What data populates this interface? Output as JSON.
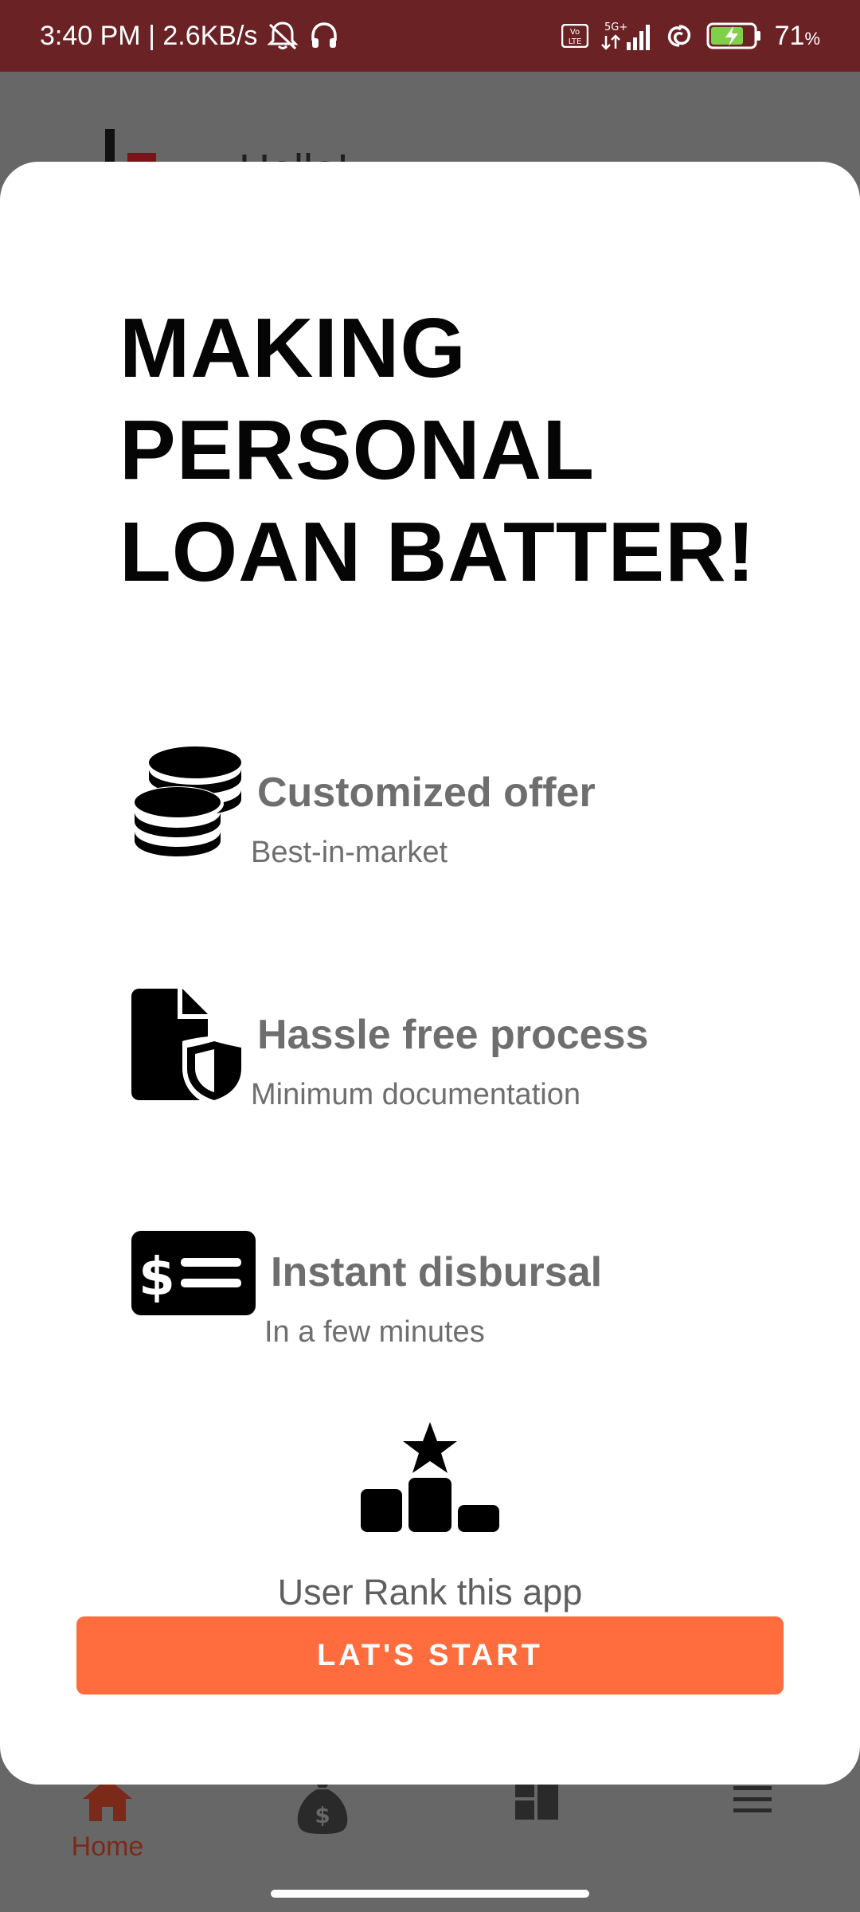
{
  "status_bar": {
    "time_speed": "3:40 PM | 2.6KB/s",
    "network_badge": "5G+",
    "volte_badge": "Vo LTE",
    "battery": "71",
    "battery_unit": "%"
  },
  "background": {
    "greeting": "Hello!",
    "nav": {
      "home_label": "Home"
    }
  },
  "modal": {
    "headline": [
      "MAKING",
      "PERSONAL",
      "LOAN BATTER!"
    ],
    "features": [
      {
        "title": "Customized offer",
        "subtitle": "Best-in-market",
        "icon": "coins-icon"
      },
      {
        "title": "Hassle free process",
        "subtitle": "Minimum documentation",
        "icon": "document-shield-icon"
      },
      {
        "title": "Instant disbursal",
        "subtitle": "In a few minutes",
        "icon": "money-bill-icon"
      }
    ],
    "rank_text": "User Rank this app",
    "rank_icon": "ranking-podium-icon",
    "start_button": "LAT'S START"
  },
  "colors": {
    "status_bar": "#6b2225",
    "accent_button": "#ff6d3e",
    "overlay": "#676767",
    "feature_text": "#6e6e6e"
  }
}
